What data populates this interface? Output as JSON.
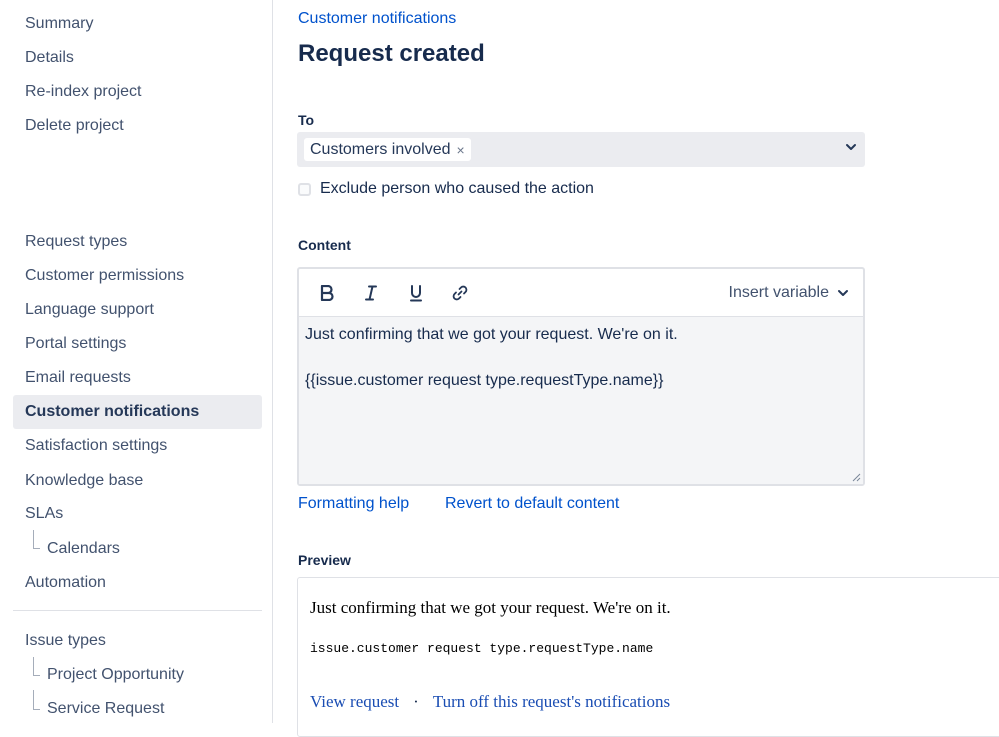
{
  "sidebar": {
    "items_top": [
      "Summary",
      "Details",
      "Re-index project",
      "Delete project"
    ],
    "items_mid": [
      "Request types",
      "Customer permissions",
      "Language support",
      "Portal settings",
      "Email requests",
      "Customer notifications",
      "Satisfaction settings",
      "Knowledge base",
      "SLAs"
    ],
    "slas_sub": "Calendars",
    "automation": "Automation",
    "issue_types": "Issue types",
    "issue_sub": [
      "Project Opportunity",
      "Service Request"
    ]
  },
  "breadcrumb": "Customer notifications",
  "page_title": "Request created",
  "to": {
    "label": "To",
    "tag": "Customers involved",
    "tag_remove": "×"
  },
  "exclude_label": "Exclude person who caused the action",
  "content": {
    "label": "Content",
    "insert_variable": "Insert variable",
    "line1": "Just confirming that we got your request. We're on it.",
    "line2": "{{issue.customer request type.requestType.name}}"
  },
  "links": {
    "formatting_help": "Formatting help",
    "revert": "Revert to default content"
  },
  "preview": {
    "label": "Preview",
    "text": "Just confirming that we got your request. We're on it.",
    "variable": "issue.customer request type.requestType.name",
    "view_request": "View request",
    "separator": "·",
    "turn_off": "Turn off this request's notifications"
  }
}
